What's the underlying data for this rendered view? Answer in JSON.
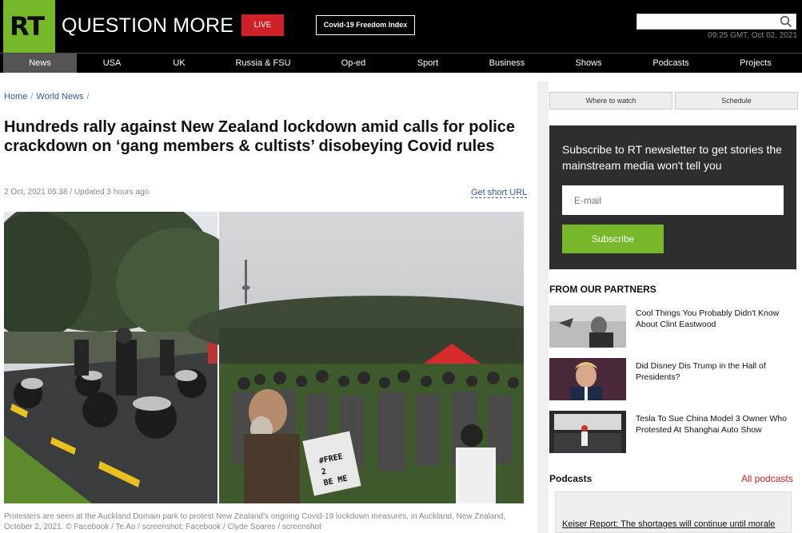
{
  "header": {
    "logo_text": "RT",
    "tagline": "QUESTION MORE",
    "live_label": "LIVE",
    "index_label": "Covid-19 Freedom Index",
    "search_placeholder": "",
    "datetime": "09:25 GMT, Oct 02, 2021"
  },
  "nav": {
    "items": [
      {
        "label": "News"
      },
      {
        "label": "USA"
      },
      {
        "label": "UK"
      },
      {
        "label": "Russia & FSU"
      },
      {
        "label": "Op-ed"
      },
      {
        "label": "Sport"
      },
      {
        "label": "Business"
      },
      {
        "label": "Shows"
      },
      {
        "label": "Podcasts"
      },
      {
        "label": "Projects"
      }
    ]
  },
  "breadcrumb": {
    "home": "Home",
    "section": "World News"
  },
  "article": {
    "headline": "Hundreds rally against New Zealand lockdown amid calls for police crackdown on ‘gang members & cultists’ disobeying Covid rules",
    "meta": "2 Oct, 2021 05:38 / Updated 3 hours ago",
    "short_url": "Get short URL",
    "caption": "Protesters are seen at the Auckland Domain park to protest New Zealand's ongoing Covid-19 lockdown measures, in Auckland, New Zealand, October 2, 2021. © Facebook / Te Ao / screenshot; Facebook / Clyde Soares / screenshot",
    "sign_text": "#FREE 2 BE ME"
  },
  "sidebar": {
    "tabs": [
      {
        "label": "Where to watch"
      },
      {
        "label": "Schedule"
      }
    ],
    "newsletter": {
      "text": "Subscribe to RT newsletter to get stories the mainstream media won't tell you",
      "email_placeholder": "E-mail",
      "button": "Subscribe"
    },
    "partners_title": "FROM OUR PARTNERS",
    "partners": [
      {
        "title": "Cool Things You Probably Didn't Know About Clint Eastwood"
      },
      {
        "title": "Did Disney Dis Trump in the Hall of Presidents?"
      },
      {
        "title": "Tesla To Sue China Model 3 Owner Who Protested At Shanghai Auto Show"
      }
    ],
    "podcasts_title": "Podcasts",
    "podcasts_link": "All podcasts",
    "podcast_item": "Keiser Report: The shortages will continue until morale"
  },
  "colors": {
    "brand_green": "#77b82a",
    "live_red": "#cf2127",
    "link_blue": "#2c5c9b"
  }
}
